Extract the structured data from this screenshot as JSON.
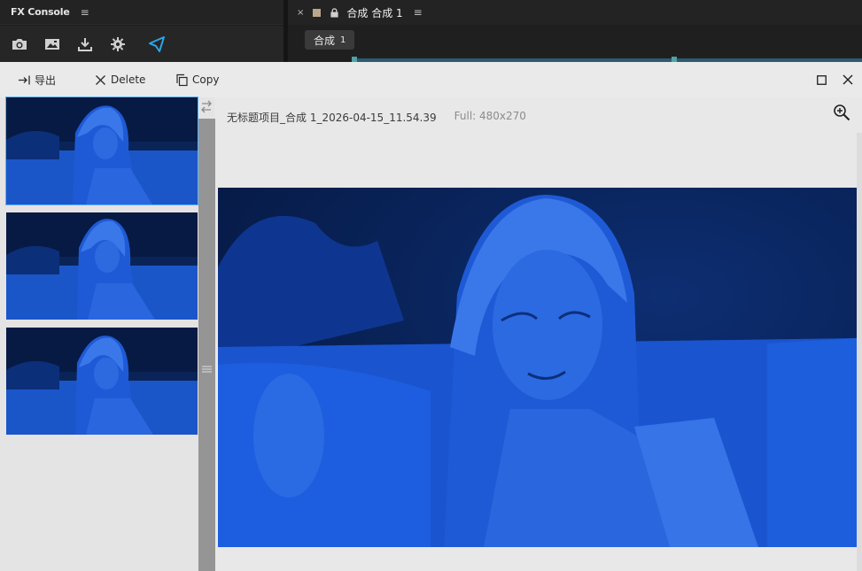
{
  "fx_console": {
    "title": "FX Console",
    "menu": "≡",
    "tools": [
      {
        "name": "camera-icon"
      },
      {
        "name": "gallery-icon"
      },
      {
        "name": "download-icon"
      },
      {
        "name": "gear-icon"
      },
      {
        "name": "fx-logo-icon"
      }
    ]
  },
  "composition": {
    "close": "×",
    "tab_title": "合成 合成 1",
    "menu": "≡",
    "chip_label": "合成",
    "chip_num": "1",
    "swatch_color": "#b9a68a"
  },
  "toolbar": {
    "export_label": "导出",
    "delete_label": "Delete",
    "copy_label": "Copy"
  },
  "preview": {
    "filename": "无标题项目_合成 1_2026-04-15_11.54.39",
    "full_size": "Full: 480x270"
  },
  "colors": {
    "accent": "#2aa6e6",
    "tint_blue": "#1463e6",
    "selection": "#5ab8ff"
  }
}
